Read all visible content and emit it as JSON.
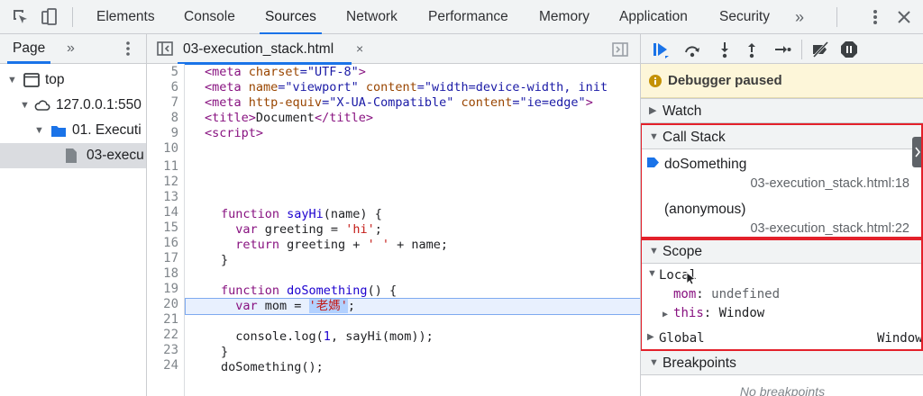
{
  "devtools": {
    "tabs": [
      "Elements",
      "Console",
      "Sources",
      "Network",
      "Performance",
      "Memory",
      "Application",
      "Security"
    ],
    "more_tabs": "»",
    "active_tab": "Sources"
  },
  "navigator": {
    "header_label": "Page",
    "more": "»",
    "tree": [
      {
        "label": "top",
        "kind": "frame"
      },
      {
        "label": "127.0.0.1:550",
        "kind": "origin"
      },
      {
        "label": "01. Executi",
        "kind": "folder"
      },
      {
        "label": "03-execu",
        "kind": "file",
        "selected": true
      }
    ]
  },
  "editor": {
    "file_tab": "03-execution_stack.html",
    "close": "×",
    "line_numbers": [
      "5",
      "6",
      "7",
      "8",
      "9",
      "10",
      "11",
      "12",
      "13",
      "14",
      "15",
      "16",
      "17",
      "18",
      "19",
      "20",
      "21",
      "22",
      "23",
      "24"
    ],
    "lines": {
      "l5": {
        "a": "<meta ",
        "b": "charset",
        "c": "=\"UTF-8\"",
        "d": ">"
      },
      "l6": {
        "a": "<meta ",
        "b": "name",
        "c": "=\"viewport\" ",
        "d": "content",
        "e": "=\"width=device-width, init"
      },
      "l7": {
        "a": "<meta ",
        "b": "http-equiv",
        "c": "=\"X-UA-Compatible\" ",
        "d": "content",
        "e": "=\"ie=edge\"",
        "f": ">"
      },
      "l8": {
        "a": "<title>",
        "b": "Document",
        "c": "</title>"
      },
      "l9": {
        "a": "<script>"
      },
      "l12": {
        "kw": "function ",
        "fn": "sayHi",
        "rest": "(name) {"
      },
      "l13": {
        "kw": "  var ",
        "rest": "greeting = ",
        "str": "'hi'",
        "end": ";"
      },
      "l14": {
        "kw": "  return ",
        "rest": "greeting + ",
        "str": "' '",
        "end": " + name;"
      },
      "l15": {
        "rest": "}"
      },
      "l17": {
        "kw": "function ",
        "fn": "doSomething",
        "rest": "() {"
      },
      "l18": {
        "kw": "  var ",
        "rest": "mom = ",
        "str": "'老媽'",
        "end": ";"
      },
      "l20": {
        "rest": "  console.log(",
        "num": "1",
        "end": ", sayHi(mom));"
      },
      "l21": {
        "rest": "}"
      },
      "l22": {
        "rest": "doSomething();"
      }
    }
  },
  "debugger": {
    "paused_text": "Debugger paused",
    "sections": {
      "watch": "Watch",
      "call_stack": "Call Stack",
      "scope": "Scope",
      "breakpoints": "Breakpoints"
    },
    "call_stack": [
      {
        "name": "doSomething",
        "location": "03-execution_stack.html:18",
        "current": true
      },
      {
        "name": "(anonymous)",
        "location": "03-execution_stack.html:22",
        "current": false
      }
    ],
    "scope": {
      "local_label": "Local",
      "vars": [
        {
          "key": "mom",
          "sep": ": ",
          "value": "undefined"
        },
        {
          "key": "this",
          "sep": ": ",
          "value": "Window"
        }
      ],
      "global_label": "Global",
      "global_value": "Window"
    },
    "breakpoints_empty": "No breakpoints"
  },
  "colors": {
    "accent": "#1a73e8",
    "highlight_box": "#e3202a",
    "paused_banner": "#fdf6d9"
  }
}
